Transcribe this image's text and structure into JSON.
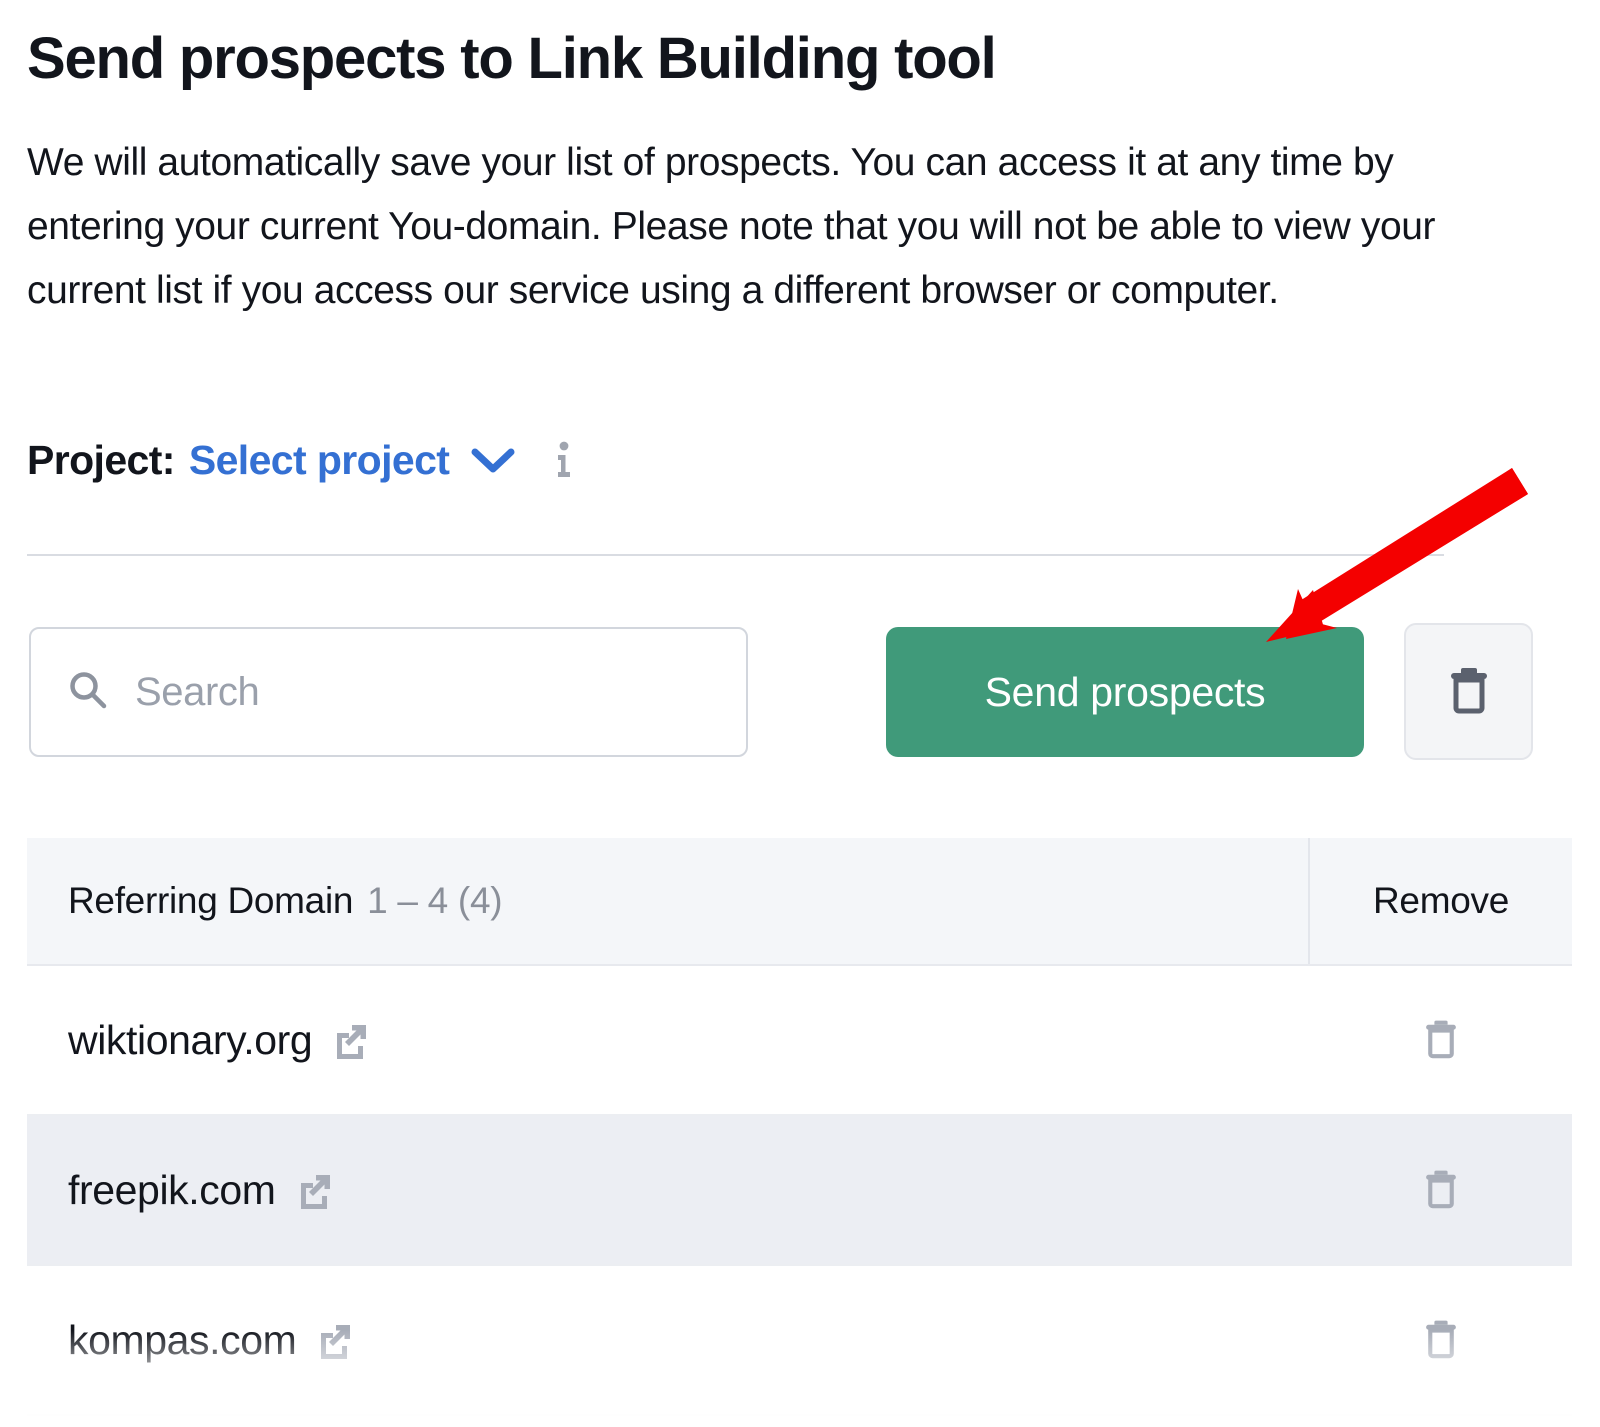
{
  "header": {
    "title": "Send prospects to Link Building tool",
    "description": "We will automatically save your list of prospects. You can access it at any time by entering your current You-domain. Please note that you will not be able to view your current list if you access our service using a different browser or computer."
  },
  "project": {
    "label": "Project:",
    "selected": "Select project",
    "chevron_icon": "chevron-down-icon",
    "info_icon": "info-icon"
  },
  "toolbar": {
    "search_placeholder": "Search",
    "search_value": "",
    "search_icon": "search-icon",
    "send_label": "Send prospects",
    "delete_all_icon": "trash-icon"
  },
  "table": {
    "columns": {
      "domain": "Referring Domain",
      "domain_count": "1 – 4 (4)",
      "remove": "Remove"
    },
    "rows": [
      {
        "domain": "wiktionary.org",
        "link_icon": "external-link-icon",
        "remove_icon": "trash-icon"
      },
      {
        "domain": "freepik.com",
        "link_icon": "external-link-icon",
        "remove_icon": "trash-icon"
      },
      {
        "domain": "kompas.com",
        "link_icon": "external-link-icon",
        "remove_icon": "trash-icon"
      }
    ]
  },
  "annotation": {
    "arrow_icon": "red-arrow-icon",
    "arrow_color": "#f40000",
    "points_to": "Send prospects"
  },
  "colors": {
    "accent_green": "#409a7a",
    "link_blue": "#3470d3",
    "text_dark": "#12151c",
    "text_muted": "#8a8f99",
    "row_alt": "#eceef3",
    "header_bg": "#f4f6f9"
  }
}
